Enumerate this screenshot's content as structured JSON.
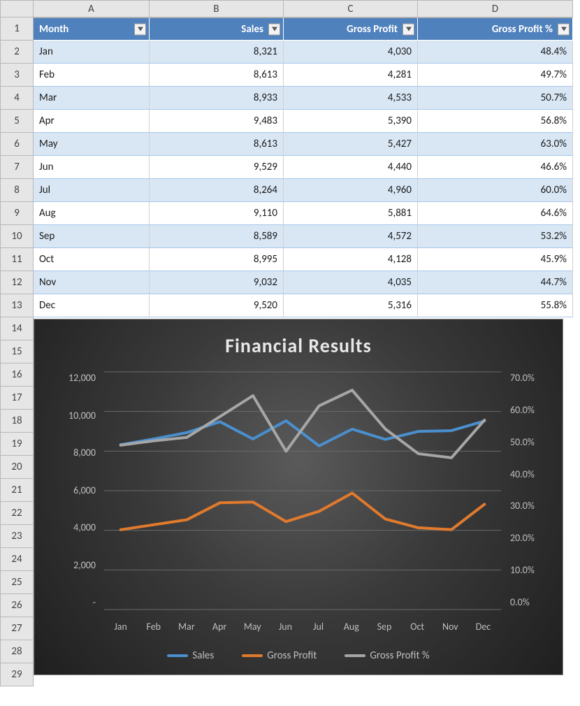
{
  "columns": [
    "A",
    "B",
    "C",
    "D"
  ],
  "headers": [
    "Month",
    "Sales",
    "Gross Profit",
    "Gross Profit %"
  ],
  "rows": [
    {
      "n": "1"
    },
    {
      "n": "2"
    },
    {
      "n": "3"
    },
    {
      "n": "4"
    },
    {
      "n": "5"
    },
    {
      "n": "6"
    },
    {
      "n": "7"
    },
    {
      "n": "8"
    },
    {
      "n": "9"
    },
    {
      "n": "10"
    },
    {
      "n": "11"
    },
    {
      "n": "12"
    },
    {
      "n": "13"
    },
    {
      "n": "14"
    },
    {
      "n": "15"
    },
    {
      "n": "16"
    },
    {
      "n": "17"
    },
    {
      "n": "18"
    },
    {
      "n": "19"
    },
    {
      "n": "20"
    },
    {
      "n": "21"
    },
    {
      "n": "22"
    },
    {
      "n": "23"
    },
    {
      "n": "24"
    },
    {
      "n": "25"
    },
    {
      "n": "26"
    },
    {
      "n": "27"
    },
    {
      "n": "28"
    },
    {
      "n": "29"
    }
  ],
  "data": [
    {
      "month": "Jan",
      "sales": "8,321",
      "gp": "4,030",
      "gpp": "48.4%"
    },
    {
      "month": "Feb",
      "sales": "8,613",
      "gp": "4,281",
      "gpp": "49.7%"
    },
    {
      "month": "Mar",
      "sales": "8,933",
      "gp": "4,533",
      "gpp": "50.7%"
    },
    {
      "month": "Apr",
      "sales": "9,483",
      "gp": "5,390",
      "gpp": "56.8%"
    },
    {
      "month": "May",
      "sales": "8,613",
      "gp": "5,427",
      "gpp": "63.0%"
    },
    {
      "month": "Jun",
      "sales": "9,529",
      "gp": "4,440",
      "gpp": "46.6%"
    },
    {
      "month": "Jul",
      "sales": "8,264",
      "gp": "4,960",
      "gpp": "60.0%"
    },
    {
      "month": "Aug",
      "sales": "9,110",
      "gp": "5,881",
      "gpp": "64.6%"
    },
    {
      "month": "Sep",
      "sales": "8,589",
      "gp": "4,572",
      "gpp": "53.2%"
    },
    {
      "month": "Oct",
      "sales": "8,995",
      "gp": "4,128",
      "gpp": "45.9%"
    },
    {
      "month": "Nov",
      "sales": "9,032",
      "gp": "4,035",
      "gpp": "44.7%"
    },
    {
      "month": "Dec",
      "sales": "9,520",
      "gp": "5,316",
      "gpp": "55.8%"
    }
  ],
  "chart": {
    "title": "Financial Results",
    "y_left": [
      "12,000",
      "10,000",
      "8,000",
      "6,000",
      "4,000",
      "2,000",
      "-"
    ],
    "y_right": [
      "70.0%",
      "60.0%",
      "50.0%",
      "40.0%",
      "30.0%",
      "20.0%",
      "10.0%",
      "0.0%"
    ],
    "legend": [
      "Sales",
      "Gross Profit",
      "Gross Profit %"
    ],
    "colors": {
      "sales": "#4a8fce",
      "gp": "#e07a2d",
      "gpp": "#a6a6a6"
    }
  },
  "chart_data": {
    "type": "line",
    "title": "Financial Results",
    "categories": [
      "Jan",
      "Feb",
      "Mar",
      "Apr",
      "May",
      "Jun",
      "Jul",
      "Aug",
      "Sep",
      "Oct",
      "Nov",
      "Dec"
    ],
    "series": [
      {
        "name": "Sales",
        "axis": "left",
        "values": [
          8321,
          8613,
          8933,
          9483,
          8613,
          9529,
          8264,
          9110,
          8589,
          8995,
          9032,
          9520
        ]
      },
      {
        "name": "Gross Profit",
        "axis": "left",
        "values": [
          4030,
          4281,
          4533,
          5390,
          5427,
          4440,
          4960,
          5881,
          4572,
          4128,
          4035,
          5316
        ]
      },
      {
        "name": "Gross Profit %",
        "axis": "right",
        "values": [
          48.4,
          49.7,
          50.7,
          56.8,
          63.0,
          46.6,
          60.0,
          64.6,
          53.2,
          45.9,
          44.7,
          55.8
        ]
      }
    ],
    "y_left_range": [
      0,
      12000
    ],
    "y_right_range": [
      0,
      70
    ],
    "y_left_ticks": [
      0,
      2000,
      4000,
      6000,
      8000,
      10000,
      12000
    ],
    "y_right_ticks": [
      0,
      10,
      20,
      30,
      40,
      50,
      60,
      70
    ],
    "xlabel": "",
    "y_left_label": "",
    "y_right_label": "",
    "grid": true,
    "legend_position": "bottom"
  }
}
